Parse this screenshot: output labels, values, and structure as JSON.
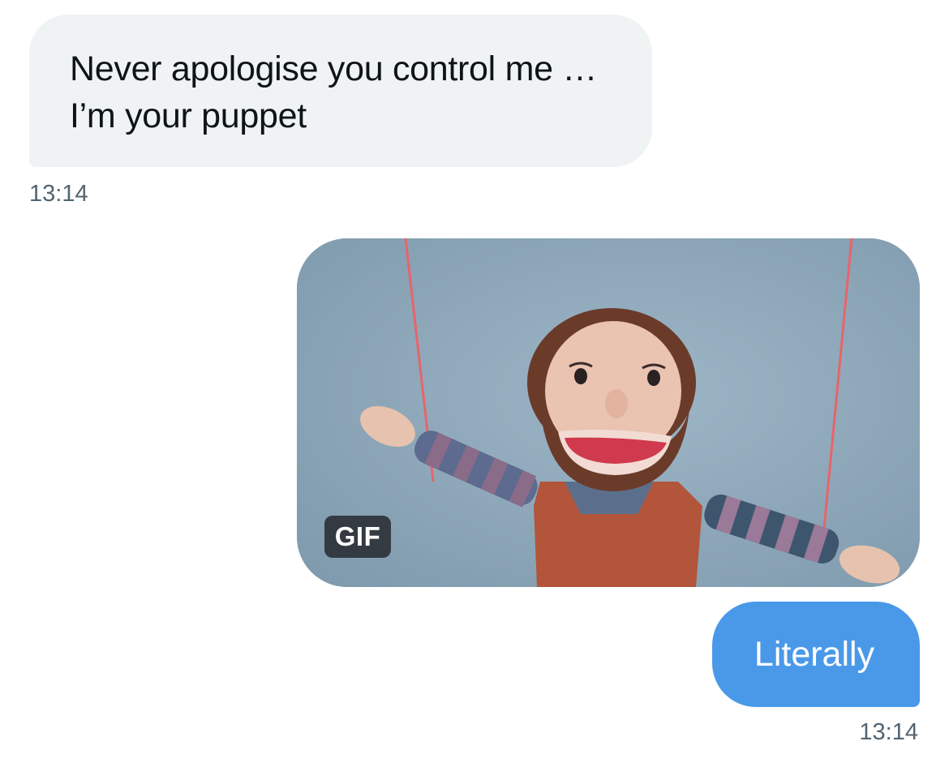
{
  "messages": [
    {
      "direction": "incoming",
      "text": "Never apologise you control me …\nI’m your puppet",
      "time": "13:14"
    },
    {
      "direction": "outgoing",
      "type": "gif",
      "badge": "GIF",
      "subject": "puppet-on-strings"
    },
    {
      "direction": "outgoing",
      "text": "Literally",
      "time": "13:14"
    }
  ],
  "colors": {
    "incoming_bubble": "#eff3f4",
    "outgoing_bubble": "#4a99e9",
    "timestamp": "#536471",
    "text_dark": "#0f1419"
  }
}
